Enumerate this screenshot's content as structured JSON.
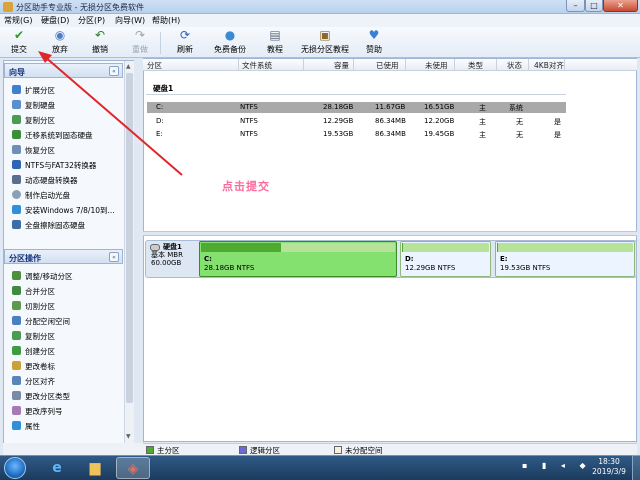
{
  "window": {
    "title": "分区助手专业版 - 无损分区免费软件",
    "min": "–",
    "max": "□",
    "close": "✕"
  },
  "menu": [
    "常规(G)",
    "硬盘(D)",
    "分区(P)",
    "向导(W)",
    "帮助(H)"
  ],
  "toolbar": {
    "submit": "提交",
    "discard": "放弃",
    "undo": "撤销",
    "redo": "重做",
    "refresh": "刷新",
    "backup": "免费备份",
    "tutorial": "教程",
    "lossless_tutorial": "无损分区教程",
    "donate": "赞助"
  },
  "wizard": {
    "title": "向导",
    "collapse": "«",
    "items": [
      "扩展分区",
      "复制硬盘",
      "复制分区",
      "迁移系统到固态硬盘",
      "恢复分区",
      "NTFS与FAT32转换器",
      "动态硬盘转换器",
      "制作启动光盘",
      "安装Windows 7/8/10到...",
      "全盘擦除固态硬盘"
    ]
  },
  "partition_ops": {
    "title": "分区操作",
    "collapse": "«",
    "items": [
      "调整/移动分区",
      "合并分区",
      "切割分区",
      "分配空闲空间",
      "复制分区",
      "创建分区",
      "更改卷标",
      "分区对齐",
      "更改分区类型",
      "更改序列号",
      "属性"
    ]
  },
  "table": {
    "headers": [
      "分区",
      "文件系统",
      "容量",
      "已使用",
      "未使用",
      "类型",
      "状态",
      "4KB对齐"
    ],
    "disk_label": "硬盘1",
    "rows": [
      {
        "part": "C:",
        "fs": "NTFS",
        "cap": "28.18GB",
        "used": "11.67GB",
        "free": "16.51GB",
        "type": "主",
        "status": "系统",
        "align": ""
      },
      {
        "part": "D:",
        "fs": "NTFS",
        "cap": "12.29GB",
        "used": "86.34MB",
        "free": "12.20GB",
        "type": "主",
        "status": "无",
        "align": "是"
      },
      {
        "part": "E:",
        "fs": "NTFS",
        "cap": "19.53GB",
        "used": "86.34MB",
        "free": "19.45GB",
        "type": "主",
        "status": "无",
        "align": "是"
      }
    ]
  },
  "annotation": "点击提交",
  "diskmap": {
    "name": "硬盘1",
    "kind": "基本 MBR",
    "size": "60.00GB",
    "partitions": [
      {
        "label": "C:",
        "info": "28.18GB NTFS",
        "used_fraction": 0.41
      },
      {
        "label": "D:",
        "info": "12.29GB NTFS",
        "used_fraction": 0.01
      },
      {
        "label": "E:",
        "info": "19.53GB NTFS",
        "used_fraction": 0.01
      }
    ]
  },
  "legend": {
    "primary": "主分区",
    "logical": "逻辑分区",
    "unallocated": "未分配空间"
  },
  "colors": {
    "primary": "#4fab2f",
    "logical": "#6b6bd6",
    "unallocated": "#f5f0e0",
    "selected_row": "#a9a9a9",
    "annotation": "#ff6a9a",
    "arrow": "#e0262a"
  },
  "taskbar": {
    "time": "18:30",
    "date": "2019/3/9"
  }
}
